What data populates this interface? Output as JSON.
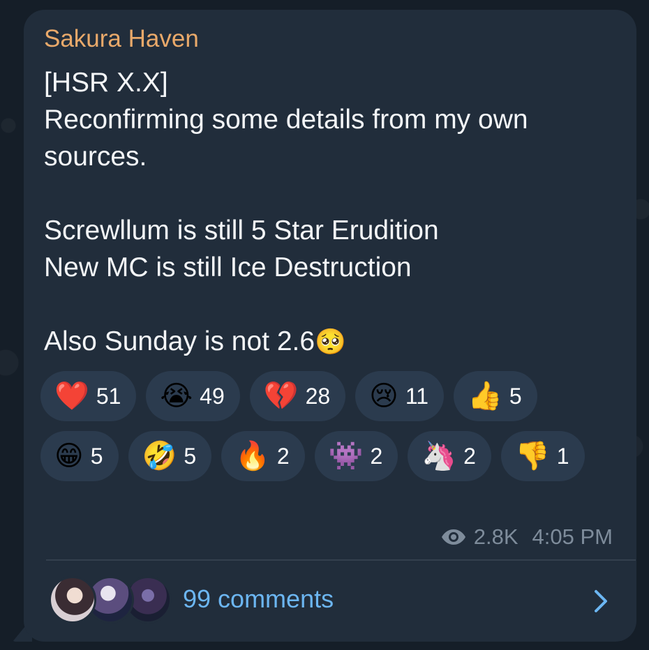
{
  "post": {
    "sender": "Sakura Haven",
    "lines": [
      "[HSR X.X]",
      "Reconfirming some details from my own sources.",
      "",
      "Screwllum is still 5 Star Erudition",
      "New MC is still Ice Destruction",
      "",
      "Also Sunday is not 2.6"
    ],
    "trailing_emoji": "🥺"
  },
  "reactions": [
    {
      "emoji": "❤️",
      "count": "51"
    },
    {
      "emoji": "😭",
      "count": "49"
    },
    {
      "emoji": "💔",
      "count": "28"
    },
    {
      "emoji": "😢",
      "count": "11"
    },
    {
      "emoji": "👍",
      "count": "5"
    },
    {
      "emoji": "😁",
      "count": "5"
    },
    {
      "emoji": "🤣",
      "count": "5"
    },
    {
      "emoji": "🔥",
      "count": "2"
    },
    {
      "emoji": "👾",
      "count": "2"
    },
    {
      "emoji": "🦄",
      "count": "2"
    },
    {
      "emoji": "👎",
      "count": "1"
    }
  ],
  "meta": {
    "views_icon": "eye-icon",
    "views": "2.8K",
    "time": "4:05 PM"
  },
  "footer": {
    "comments_label": "99 comments",
    "chevron_icon": "chevron-right-icon"
  },
  "colors": {
    "sender": "#e9a96a",
    "link": "#6cb6f2",
    "bubble": "#212d3b",
    "chip": "#2b3b4e"
  }
}
